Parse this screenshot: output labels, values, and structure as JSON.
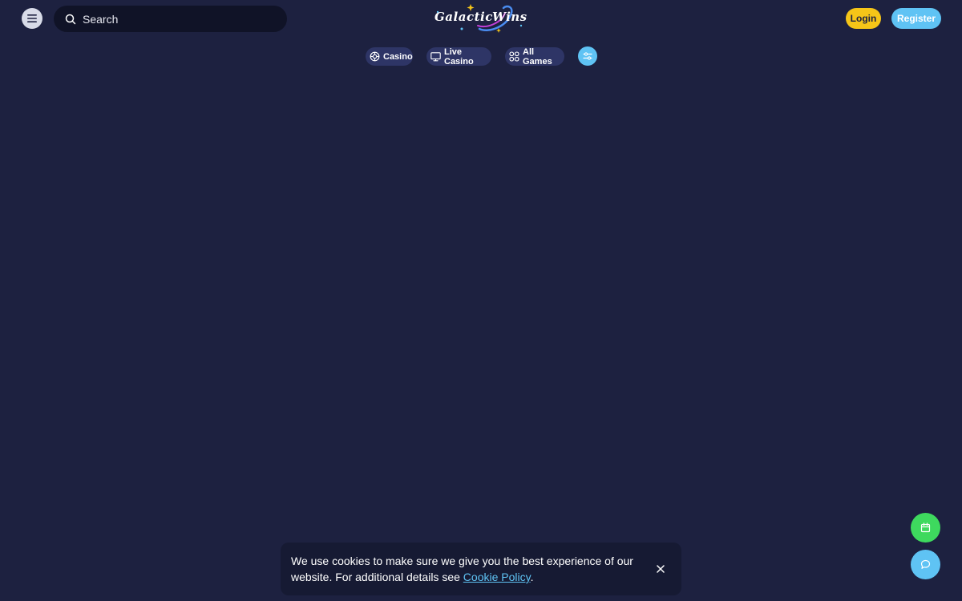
{
  "header": {
    "search_placeholder": "Search",
    "logo_text_left": "Galactic",
    "logo_text_right": "Wins",
    "login_label": "Login",
    "register_label": "Register"
  },
  "categories": [
    {
      "label": "Casino",
      "icon": "globe-icon"
    },
    {
      "label": "Live Casino",
      "icon": "live-tv-icon"
    },
    {
      "label": "All Games",
      "icon": "grid-icon"
    }
  ],
  "filter_icon": "sliders-icon",
  "floating": {
    "gift_icon": "gift-icon",
    "chat_icon": "chat-icon"
  },
  "cookie": {
    "text": "We use cookies to make sure we give you the best experience of our website. For additional details see ",
    "link_label": "Cookie Policy",
    "suffix": "."
  },
  "colors": {
    "background": "#1d2140",
    "accent_yellow": "#f5c518",
    "accent_blue": "#5fc3f4",
    "accent_green": "#3ed95e",
    "pill_bg": "#2e3566"
  }
}
